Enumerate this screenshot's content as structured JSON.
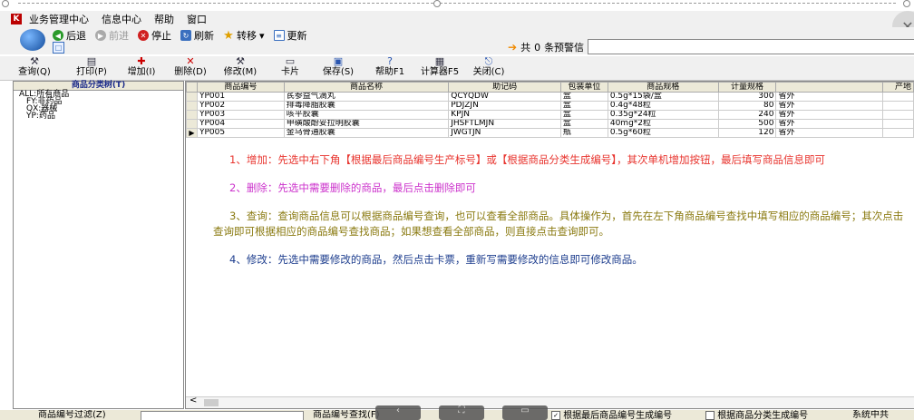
{
  "menu": [
    "业务管理中心",
    "信息中心",
    "帮助",
    "窗口"
  ],
  "nav": {
    "back": "后退",
    "forward": "前进",
    "stop": "停止",
    "refresh": "刷新",
    "goto": "转移",
    "update": "更新"
  },
  "alert": {
    "prefix": "共",
    "count": "0",
    "suffix": "条预警信"
  },
  "toolbar": {
    "query": "查询(Q)",
    "print": "打印(P)",
    "add": "增加(I)",
    "delete": "删除(D)",
    "modify": "修改(M)",
    "card": "卡片",
    "save": "保存(S)",
    "help": "帮助F1",
    "calculator": "计算器F5",
    "close": "关闭(C)"
  },
  "tree": {
    "title": "商品分类树(T)",
    "items": [
      "ALL:所有商品",
      "FY:非药品",
      "QX:器械",
      "YP:药品"
    ]
  },
  "grid": {
    "columns": [
      "商品编号",
      "商品名称",
      "助记码",
      "包装单位",
      "商品规格",
      "计量规格",
      "",
      "产地"
    ],
    "rows": [
      {
        "code": "YP001",
        "name": "芪参益气滴丸",
        "mnemonic": "QCYQDW",
        "unit": "盒",
        "spec": "0.5g*15袋/盒",
        "measure": "300",
        "origin": "省外"
      },
      {
        "code": "YP002",
        "name": "排毒降脂胶囊",
        "mnemonic": "PDJZJN",
        "unit": "盒",
        "spec": "0.4g*48粒",
        "measure": "80",
        "origin": "省外"
      },
      {
        "code": "YP003",
        "name": "咳平胶囊",
        "mnemonic": "KPJN",
        "unit": "盒",
        "spec": "0.35g*24粒",
        "measure": "240",
        "origin": "省外"
      },
      {
        "code": "YP004",
        "name": "甲磺酸酚妥拉明胶囊",
        "mnemonic": "JHSFTLMJN",
        "unit": "盒",
        "spec": "40mg*2粒",
        "measure": "500",
        "origin": "省外"
      },
      {
        "code": "YP005",
        "name": "金乌骨通胶囊",
        "mnemonic": "JWGTJN",
        "unit": "瓶",
        "spec": "0.5g*60粒",
        "measure": "120",
        "origin": "省外"
      }
    ]
  },
  "notes": {
    "add": "1、增加：先选中右下角【根据最后商品编号生产标号】或【根据商品分类生成编号】，其次单机增加按钮，最后填写商品信息即可",
    "delete": "2、删除：先选中需要删除的商品，最后点击删除即可",
    "query": "3、查询：查询商品信息可以根据商品编号查询，也可以查看全部商品。具体操作为，首先在左下角商品编号查找中填写相应的商品编号；其次点击查询即可根据相应的商品编号查找商品；如果想查看全部商品，则直接点击查询即可。",
    "modify": "4、修改：先选中需要修改的商品，然后点击卡票，重新写需要修改的信息即可修改商品。"
  },
  "status": {
    "filter_label": "商品编号过滤(Z)",
    "find_label": "商品编号查找(F)",
    "opt_last": "根据最后商品编号生成编号",
    "opt_category": "根据商品分类生成编号",
    "system": "系统中共"
  },
  "colors": {
    "note1": "#e8342e",
    "note2": "#cc33cc",
    "note3": "#8a7a10",
    "note4": "#1f3f8f"
  }
}
